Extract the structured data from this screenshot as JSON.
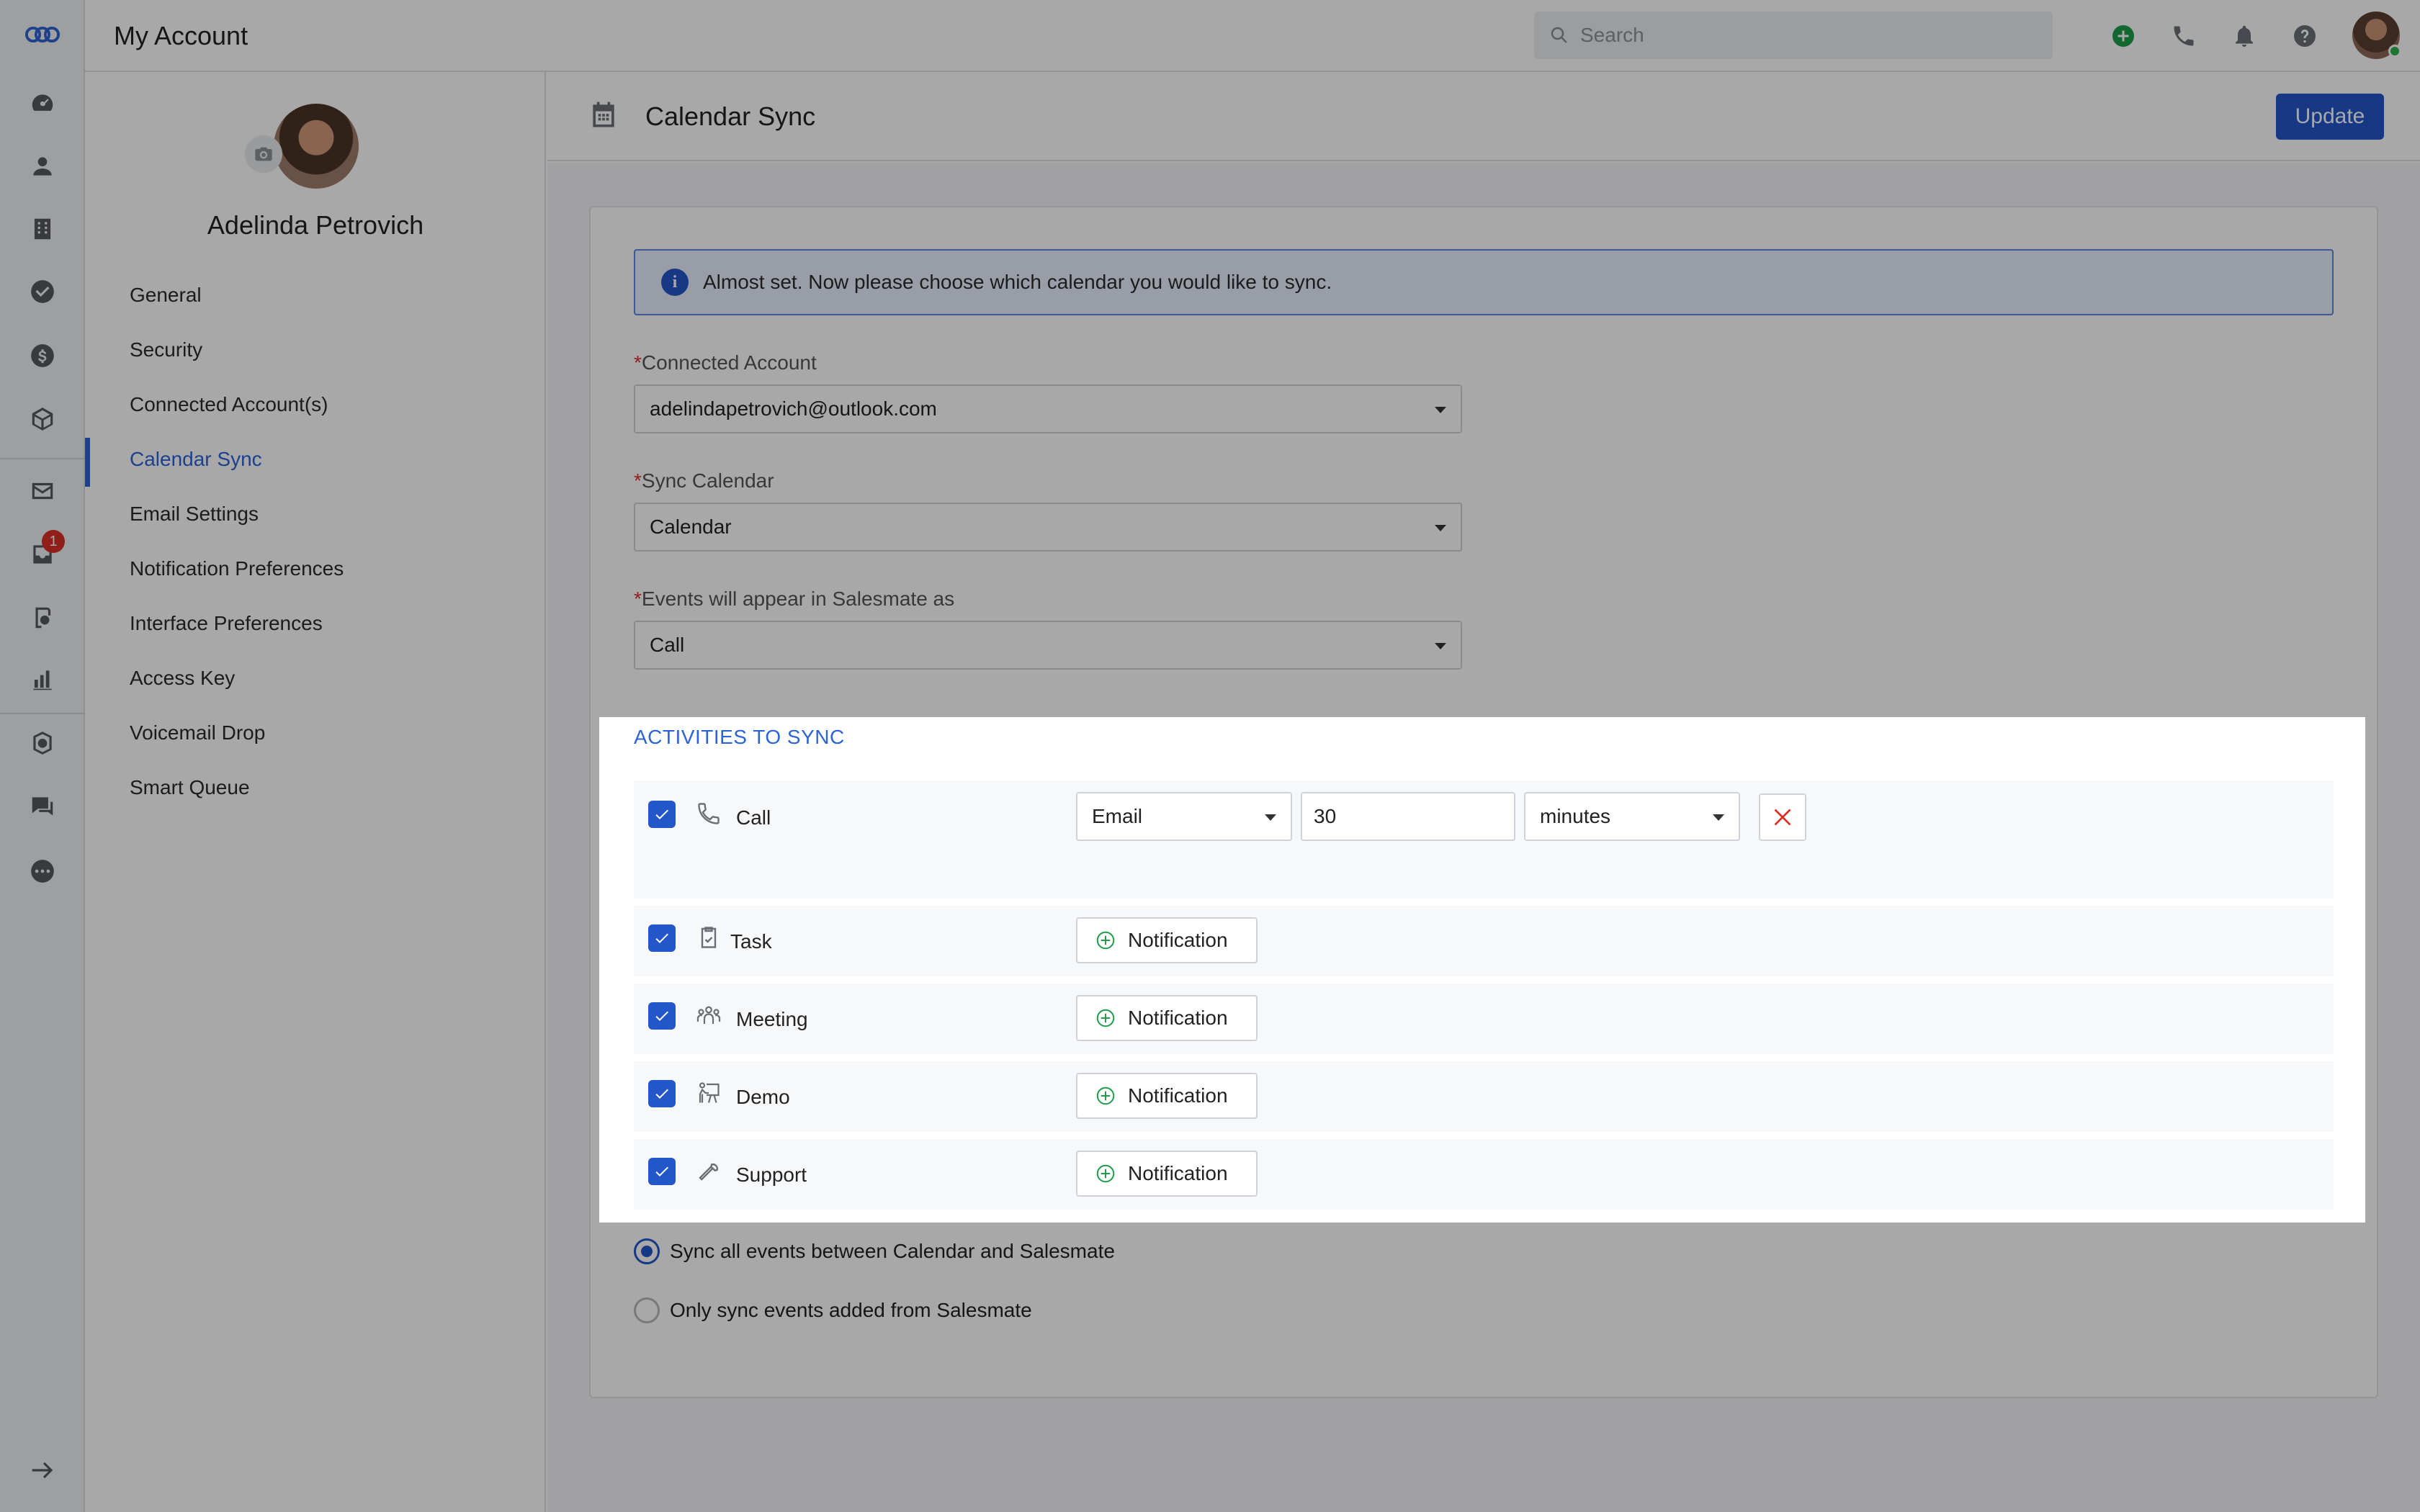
{
  "header": {
    "title": "My Account",
    "search_placeholder": "Search"
  },
  "icons": {
    "logo": "salesmate-logo-icon",
    "rail": [
      "dashboard-icon",
      "contacts-icon",
      "companies-icon",
      "activities-icon",
      "deals-icon",
      "products-icon",
      "email-icon",
      "inbox-icon",
      "sequences-icon",
      "reports-icon",
      "automation-icon",
      "chat-icon",
      "more-icon",
      "expand-icon"
    ],
    "top": [
      "add-icon",
      "phone-icon",
      "bell-icon",
      "help-icon"
    ]
  },
  "rail_badge": "1",
  "colors": {
    "accent": "#2356c8",
    "active_link": "#2c63d6",
    "add_green": "#1e9e4a",
    "remove_red": "#d93025"
  },
  "profile": {
    "name": "Adelinda Petrovich"
  },
  "nav": {
    "items": [
      {
        "label": "General"
      },
      {
        "label": "Security"
      },
      {
        "label": "Connected Account(s)"
      },
      {
        "label": "Calendar Sync"
      },
      {
        "label": "Email Settings"
      },
      {
        "label": "Notification Preferences"
      },
      {
        "label": "Interface Preferences"
      },
      {
        "label": "Access Key"
      },
      {
        "label": "Voicemail Drop"
      },
      {
        "label": "Smart Queue"
      }
    ],
    "active": "Calendar Sync"
  },
  "main": {
    "title": "Calendar Sync",
    "update_label": "Update",
    "info_text": "Almost set. Now please choose which calendar you would like to sync.",
    "required_mark": "*",
    "connected_account": {
      "label": "Connected Account",
      "value": "adelindapetrovich@outlook.com"
    },
    "sync_calendar": {
      "label": "Sync Calendar",
      "value": "Calendar"
    },
    "events_as": {
      "label": "Events will appear in Salesmate as",
      "value": "Call"
    }
  },
  "activities": {
    "title": "ACTIVITIES TO SYNC",
    "call": {
      "label": "Call",
      "checked": true,
      "reminder_type": "Email",
      "reminder_value": "30",
      "reminder_unit": "minutes"
    },
    "rows": [
      {
        "label": "Task",
        "checked": true,
        "button": "Notification",
        "icon": "task-icon"
      },
      {
        "label": "Meeting",
        "checked": true,
        "button": "Notification",
        "icon": "meeting-icon"
      },
      {
        "label": "Demo",
        "checked": true,
        "button": "Notification",
        "icon": "demo-icon"
      },
      {
        "label": "Support",
        "checked": true,
        "button": "Notification",
        "icon": "support-icon"
      }
    ]
  },
  "sync_options": [
    {
      "label": "Sync all events between Calendar and Salesmate",
      "selected": true
    },
    {
      "label": "Only sync events added from Salesmate",
      "selected": false
    }
  ]
}
